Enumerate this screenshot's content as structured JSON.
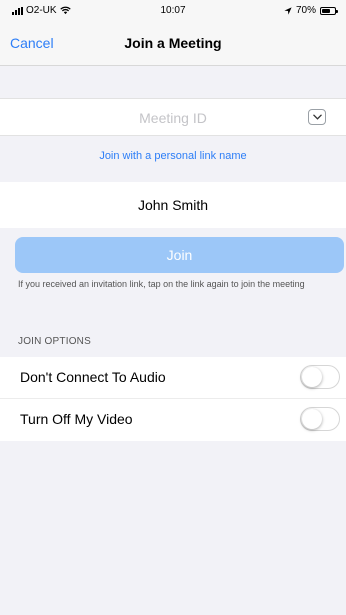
{
  "status_bar": {
    "carrier": "O2-UK",
    "time": "10:07",
    "battery": "70%",
    "battery_level": 0.7
  },
  "nav": {
    "cancel_label": "Cancel",
    "title": "Join a Meeting"
  },
  "meeting": {
    "placeholder": "Meeting ID",
    "value": ""
  },
  "link": {
    "label": "Join with a personal link name"
  },
  "name": {
    "value": "John Smith"
  },
  "join": {
    "label": "Join",
    "hint": "If you received an invitation link, tap on the link again to join the meeting"
  },
  "options": {
    "header": "JOIN OPTIONS",
    "items": [
      {
        "label": "Don't Connect To Audio",
        "enabled": false
      },
      {
        "label": "Turn Off My Video",
        "enabled": false
      }
    ]
  },
  "colors": {
    "accent": "#2d7ef7",
    "join_button": "#9cc7f8",
    "background": "#f2f2f7"
  },
  "icons": {
    "wifi": "wifi-icon",
    "signal": "signal-icon",
    "location": "location-arrow-icon",
    "battery": "battery-icon",
    "dropdown": "chevron-down-icon"
  }
}
